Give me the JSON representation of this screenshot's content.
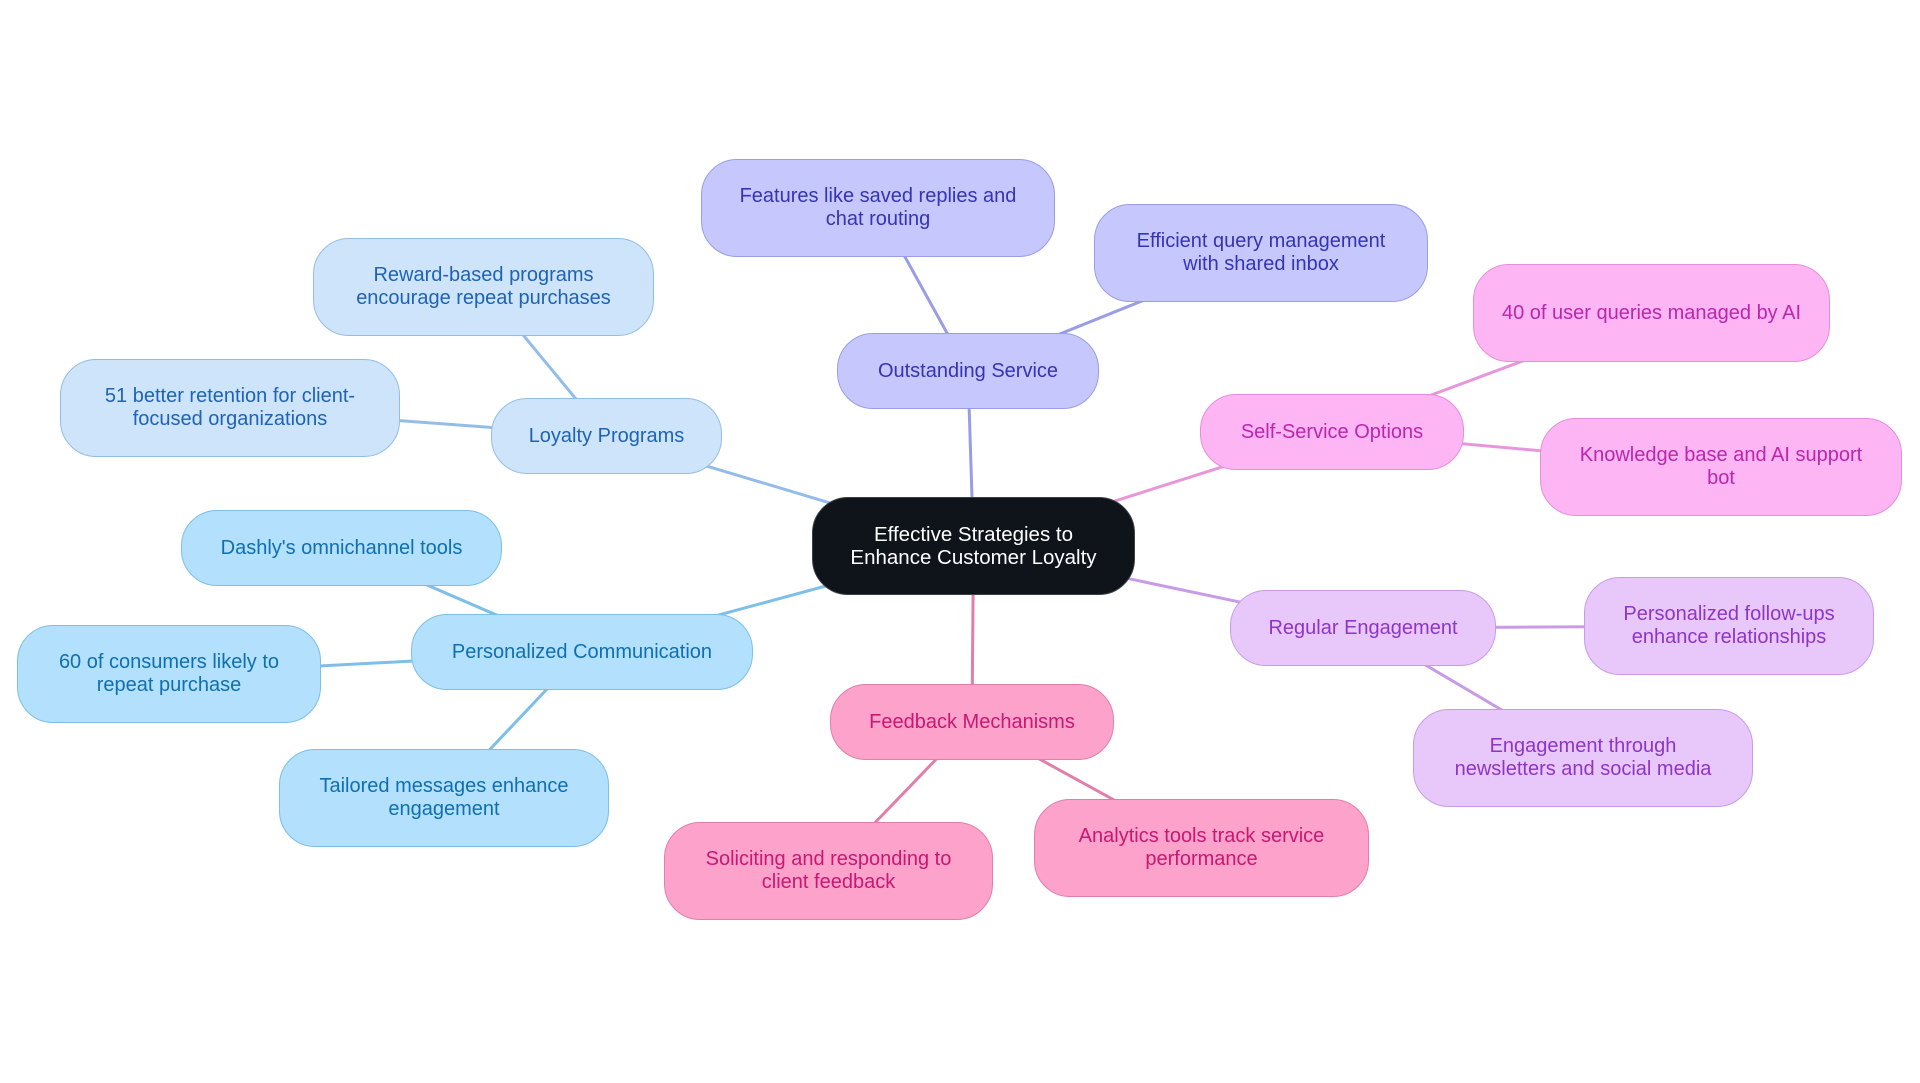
{
  "diagram": {
    "type": "mindmap",
    "root": {
      "label": "Effective Strategies to Enhance Customer Loyalty"
    },
    "branches": [
      {
        "id": "service",
        "label": "Outstanding Service",
        "color": "#9a9de6",
        "children": [
          "Features like saved replies and chat routing",
          "Efficient query management with shared inbox"
        ]
      },
      {
        "id": "self",
        "label": "Self-Service Options",
        "color": "#e896dc",
        "children": [
          "40 of user queries managed by AI",
          "Knowledge base and AI support bot"
        ]
      },
      {
        "id": "engage",
        "label": "Regular Engagement",
        "color": "#c99be6",
        "children": [
          "Personalized follow-ups enhance relationships",
          "Engagement through newsletters and social media"
        ]
      },
      {
        "id": "feedback",
        "label": "Feedback Mechanisms",
        "color": "#e07fab",
        "children": [
          "Soliciting and responding to client feedback",
          "Analytics tools track service performance"
        ]
      },
      {
        "id": "comm",
        "label": "Personalized Communication",
        "color": "#7dbfe8",
        "children": [
          "Dashly's omnichannel tools",
          "60 of consumers likely to repeat purchase",
          "Tailored messages enhance engagement"
        ]
      },
      {
        "id": "loyalty",
        "label": "Loyalty Programs",
        "color": "#93bde8",
        "children": [
          "Reward-based programs encourage repeat purchases",
          "51 better retention for client-focused organizations"
        ]
      }
    ]
  }
}
